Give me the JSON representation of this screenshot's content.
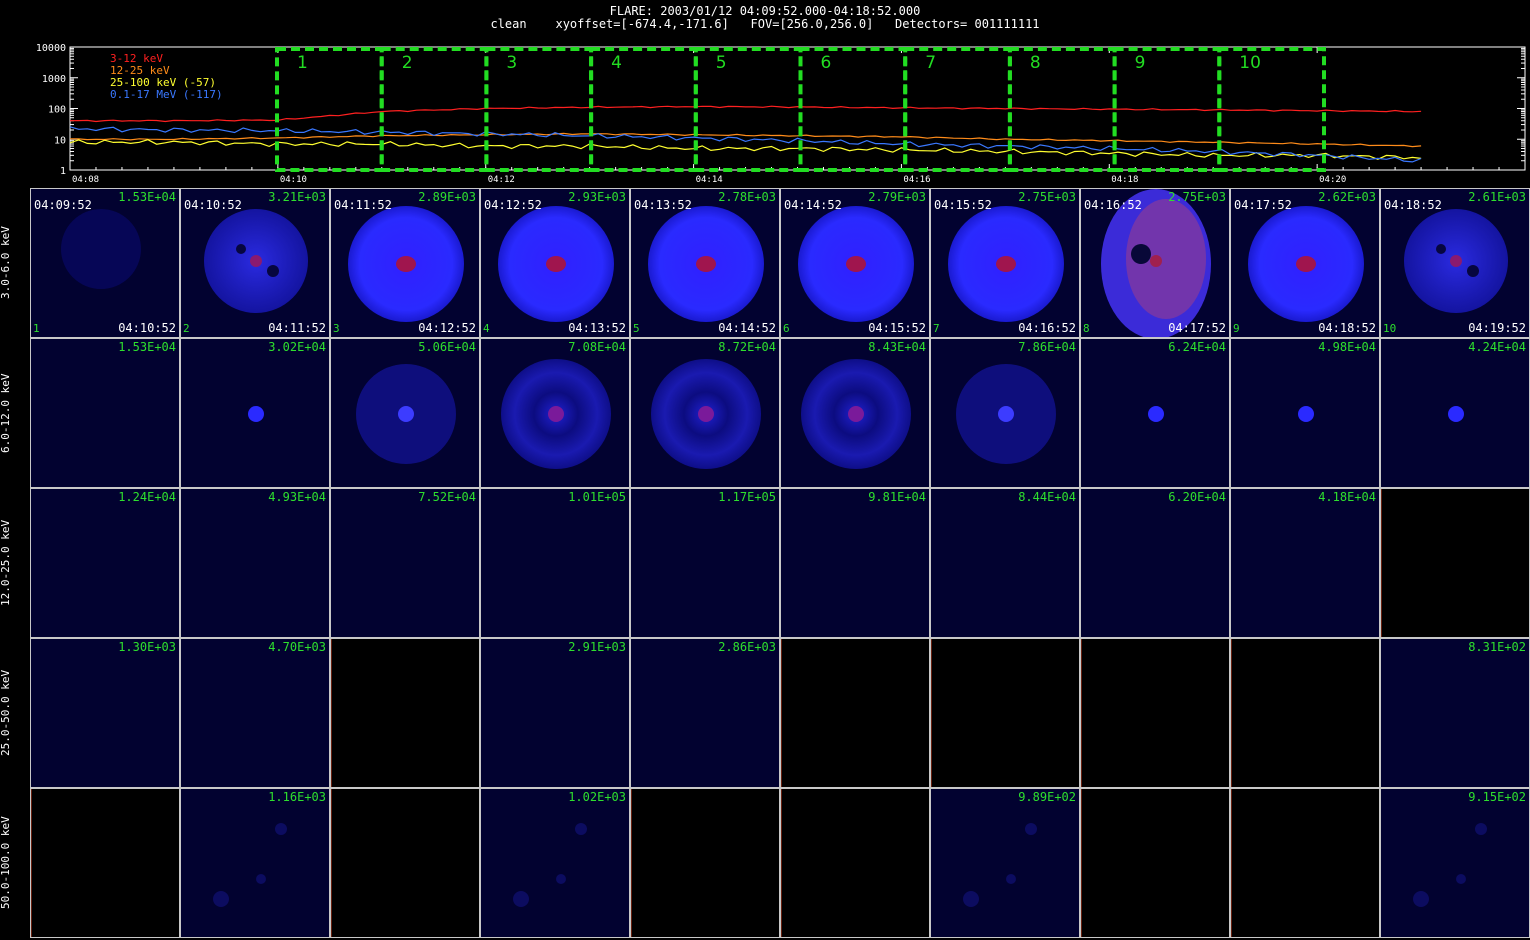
{
  "header": {
    "line1": "FLARE: 2003/01/12 04:09:52.000-04:18:52.000",
    "line2": "clean    xyoffset=[-674.4,-171.6]   FOV=[256.0,256.0]   Detectors= 001111111"
  },
  "chart_data": {
    "type": "line",
    "yscale": "log",
    "ylim": [
      1,
      10000
    ],
    "yticks": [
      "10000",
      "1000",
      "100",
      "10",
      "1"
    ],
    "xticks": [
      "04:08",
      "04:10",
      "04:12",
      "04:14",
      "04:16",
      "04:18",
      "04:20"
    ],
    "legend": [
      {
        "label": "3-12 keV",
        "color": "#ff2020"
      },
      {
        "label": "12-25 keV",
        "color": "#ff8c1a"
      },
      {
        "label": "25-100 keV (-57)",
        "color": "#ffff30"
      },
      {
        "label": "0.1-17 MeV (-117)",
        "color": "#3a78ff"
      }
    ],
    "series": [
      {
        "name": "3-12 keV",
        "color": "#ff2020",
        "x": [
          "04:08",
          "04:09",
          "04:10",
          "04:11",
          "04:12",
          "04:13",
          "04:14",
          "04:15",
          "04:16",
          "04:17",
          "04:18",
          "04:19",
          "04:20",
          "04:21"
        ],
        "y": [
          40,
          40,
          42,
          80,
          100,
          110,
          115,
          112,
          105,
          100,
          95,
          90,
          85,
          80
        ]
      },
      {
        "name": "12-25 keV",
        "color": "#ff8c1a",
        "x": [
          "04:08",
          "04:09",
          "04:10",
          "04:11",
          "04:12",
          "04:13",
          "04:14",
          "04:15",
          "04:16",
          "04:17",
          "04:18",
          "04:19",
          "04:20",
          "04:21"
        ],
        "y": [
          10,
          10,
          11,
          13,
          14,
          15,
          14,
          13,
          12,
          10,
          9,
          8,
          7,
          6
        ]
      },
      {
        "name": "25-100 keV (-57)",
        "color": "#ffff30",
        "x": [
          "04:08",
          "04:09",
          "04:10",
          "04:11",
          "04:12",
          "04:13",
          "04:14",
          "04:15",
          "04:16",
          "04:17",
          "04:18",
          "04:19",
          "04:20",
          "04:21"
        ],
        "y": [
          8,
          8,
          7,
          7,
          6,
          6,
          5,
          5,
          4.5,
          4,
          3.5,
          3,
          3,
          2.5
        ]
      },
      {
        "name": "0.1-17 MeV (-117)",
        "color": "#3a78ff",
        "x": [
          "04:08",
          "04:09",
          "04:10",
          "04:11",
          "04:12",
          "04:13",
          "04:14",
          "04:15",
          "04:16",
          "04:17",
          "04:18",
          "04:19",
          "04:20",
          "04:21"
        ],
        "y": [
          22,
          20,
          19,
          17,
          15,
          13,
          11,
          9,
          7,
          6,
          5,
          4,
          3,
          2
        ]
      }
    ],
    "intervals": [
      "1",
      "2",
      "3",
      "4",
      "5",
      "6",
      "7",
      "8",
      "9",
      "10"
    ],
    "interval_color": "#22dd22"
  },
  "grid": {
    "energies": [
      "3.0-6.0 keV",
      "6.0-12.0 keV",
      "12.0-25.0 keV",
      "25.0-50.0 keV",
      "50.0-100.0 keV"
    ],
    "start_times": [
      "04:09:52",
      "04:10:52",
      "04:11:52",
      "04:12:52",
      "04:13:52",
      "04:14:52",
      "04:15:52",
      "04:16:52",
      "04:17:52",
      "04:18:52"
    ],
    "end_times": [
      "04:10:52",
      "04:11:52",
      "04:12:52",
      "04:13:52",
      "04:14:52",
      "04:15:52",
      "04:16:52",
      "04:17:52",
      "04:18:52",
      "04:19:52"
    ],
    "numbers": [
      "1",
      "2",
      "3",
      "4",
      "5",
      "6",
      "7",
      "8",
      "9",
      "10"
    ],
    "rows": [
      [
        {
          "value": "1.53E+04",
          "kind": "faint"
        },
        {
          "value": "3.21E+03",
          "kind": "patchy"
        },
        {
          "value": "2.89E+03",
          "kind": "disk"
        },
        {
          "value": "2.93E+03",
          "kind": "disk"
        },
        {
          "value": "2.78E+03",
          "kind": "disk"
        },
        {
          "value": "2.79E+03",
          "kind": "disk"
        },
        {
          "value": "2.75E+03",
          "kind": "disk"
        },
        {
          "value": "2.75E+03",
          "kind": "odd"
        },
        {
          "value": "2.62E+03",
          "kind": "disk"
        },
        {
          "value": "2.61E+03",
          "kind": "patchy"
        }
      ],
      [
        {
          "value": "1.53E+04",
          "kind": "blank"
        },
        {
          "value": "3.02E+04",
          "kind": "spot"
        },
        {
          "value": "5.06E+04",
          "kind": "faintdisk"
        },
        {
          "value": "7.08E+04",
          "kind": "ring"
        },
        {
          "value": "8.72E+04",
          "kind": "ring"
        },
        {
          "value": "8.43E+04",
          "kind": "ring"
        },
        {
          "value": "7.86E+04",
          "kind": "faintdisk"
        },
        {
          "value": "6.24E+04",
          "kind": "spot"
        },
        {
          "value": "4.98E+04",
          "kind": "spot"
        },
        {
          "value": "4.24E+04",
          "kind": "spot"
        }
      ],
      [
        {
          "value": "1.24E+04",
          "kind": "blank"
        },
        {
          "value": "4.93E+04",
          "kind": "blank"
        },
        {
          "value": "7.52E+04",
          "kind": "blank"
        },
        {
          "value": "1.01E+05",
          "kind": "blank"
        },
        {
          "value": "1.17E+05",
          "kind": "blank"
        },
        {
          "value": "9.81E+04",
          "kind": "blank"
        },
        {
          "value": "8.44E+04",
          "kind": "blank"
        },
        {
          "value": "6.20E+04",
          "kind": "blank"
        },
        {
          "value": "4.18E+04",
          "kind": "blank"
        },
        {
          "value": "",
          "kind": "empty"
        }
      ],
      [
        {
          "value": "1.30E+03",
          "kind": "blank"
        },
        {
          "value": "4.70E+03",
          "kind": "blank"
        },
        {
          "value": "",
          "kind": "empty"
        },
        {
          "value": "2.91E+03",
          "kind": "blank"
        },
        {
          "value": "2.86E+03",
          "kind": "blank"
        },
        {
          "value": "",
          "kind": "empty"
        },
        {
          "value": "",
          "kind": "empty"
        },
        {
          "value": "",
          "kind": "empty"
        },
        {
          "value": "",
          "kind": "empty"
        },
        {
          "value": "8.31E+02",
          "kind": "blank"
        }
      ],
      [
        {
          "value": "",
          "kind": "empty"
        },
        {
          "value": "1.16E+03",
          "kind": "noise"
        },
        {
          "value": "",
          "kind": "empty"
        },
        {
          "value": "1.02E+03",
          "kind": "noise"
        },
        {
          "value": "",
          "kind": "empty"
        },
        {
          "value": "",
          "kind": "empty"
        },
        {
          "value": "9.89E+02",
          "kind": "noise"
        },
        {
          "value": "",
          "kind": "empty"
        },
        {
          "value": "",
          "kind": "empty"
        },
        {
          "value": "9.15E+02",
          "kind": "noise"
        }
      ]
    ]
  }
}
